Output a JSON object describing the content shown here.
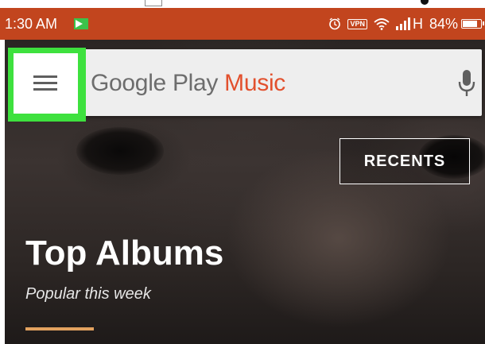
{
  "status_bar": {
    "time": "1:30 AM",
    "network_type": "H",
    "battery_percent": "84%",
    "battery_level": 0.84,
    "background_color": "#c2451e",
    "icons": [
      "notification-flag-icon",
      "alarm-clock-icon",
      "vpn-key-icon",
      "wifi-icon",
      "cell-signal-icon",
      "battery-icon"
    ],
    "vpn_label": "VPN"
  },
  "search_bar": {
    "title_prefix": "Google Play ",
    "title_accent": "Music",
    "accent_color": "#e2502d",
    "menu_icon": "hamburger-menu-icon",
    "mic_icon": "microphone-icon",
    "highlight_color": "#3ee13e"
  },
  "hero": {
    "recents_label": "RECENTS",
    "title": "Top Albums",
    "subtitle": "Popular this week",
    "underline_color": "#e2a25f"
  }
}
